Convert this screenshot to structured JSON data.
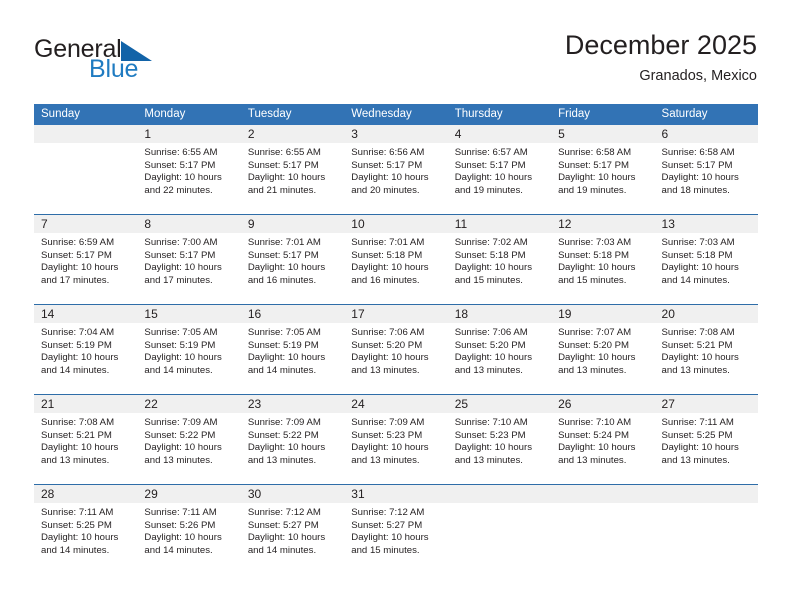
{
  "brand": {
    "name_part1": "General",
    "name_part2": "Blue",
    "triangle_color": "#1263a8",
    "blue_color": "#1f7bc1"
  },
  "header": {
    "title": "December 2025",
    "location": "Granados, Mexico",
    "header_bg": "#3273b5",
    "header_text_color": "#ffffff",
    "daynum_bg": "#f0f0f0",
    "week_rule_color": "#2e6da8"
  },
  "weekdays": [
    "Sunday",
    "Monday",
    "Tuesday",
    "Wednesday",
    "Thursday",
    "Friday",
    "Saturday"
  ],
  "weeks": [
    [
      {
        "day": "",
        "sunrise": "",
        "sunset": "",
        "daylight1": "",
        "daylight2": ""
      },
      {
        "day": "1",
        "sunrise": "Sunrise: 6:55 AM",
        "sunset": "Sunset: 5:17 PM",
        "daylight1": "Daylight: 10 hours",
        "daylight2": "and 22 minutes."
      },
      {
        "day": "2",
        "sunrise": "Sunrise: 6:55 AM",
        "sunset": "Sunset: 5:17 PM",
        "daylight1": "Daylight: 10 hours",
        "daylight2": "and 21 minutes."
      },
      {
        "day": "3",
        "sunrise": "Sunrise: 6:56 AM",
        "sunset": "Sunset: 5:17 PM",
        "daylight1": "Daylight: 10 hours",
        "daylight2": "and 20 minutes."
      },
      {
        "day": "4",
        "sunrise": "Sunrise: 6:57 AM",
        "sunset": "Sunset: 5:17 PM",
        "daylight1": "Daylight: 10 hours",
        "daylight2": "and 19 minutes."
      },
      {
        "day": "5",
        "sunrise": "Sunrise: 6:58 AM",
        "sunset": "Sunset: 5:17 PM",
        "daylight1": "Daylight: 10 hours",
        "daylight2": "and 19 minutes."
      },
      {
        "day": "6",
        "sunrise": "Sunrise: 6:58 AM",
        "sunset": "Sunset: 5:17 PM",
        "daylight1": "Daylight: 10 hours",
        "daylight2": "and 18 minutes."
      }
    ],
    [
      {
        "day": "7",
        "sunrise": "Sunrise: 6:59 AM",
        "sunset": "Sunset: 5:17 PM",
        "daylight1": "Daylight: 10 hours",
        "daylight2": "and 17 minutes."
      },
      {
        "day": "8",
        "sunrise": "Sunrise: 7:00 AM",
        "sunset": "Sunset: 5:17 PM",
        "daylight1": "Daylight: 10 hours",
        "daylight2": "and 17 minutes."
      },
      {
        "day": "9",
        "sunrise": "Sunrise: 7:01 AM",
        "sunset": "Sunset: 5:17 PM",
        "daylight1": "Daylight: 10 hours",
        "daylight2": "and 16 minutes."
      },
      {
        "day": "10",
        "sunrise": "Sunrise: 7:01 AM",
        "sunset": "Sunset: 5:18 PM",
        "daylight1": "Daylight: 10 hours",
        "daylight2": "and 16 minutes."
      },
      {
        "day": "11",
        "sunrise": "Sunrise: 7:02 AM",
        "sunset": "Sunset: 5:18 PM",
        "daylight1": "Daylight: 10 hours",
        "daylight2": "and 15 minutes."
      },
      {
        "day": "12",
        "sunrise": "Sunrise: 7:03 AM",
        "sunset": "Sunset: 5:18 PM",
        "daylight1": "Daylight: 10 hours",
        "daylight2": "and 15 minutes."
      },
      {
        "day": "13",
        "sunrise": "Sunrise: 7:03 AM",
        "sunset": "Sunset: 5:18 PM",
        "daylight1": "Daylight: 10 hours",
        "daylight2": "and 14 minutes."
      }
    ],
    [
      {
        "day": "14",
        "sunrise": "Sunrise: 7:04 AM",
        "sunset": "Sunset: 5:19 PM",
        "daylight1": "Daylight: 10 hours",
        "daylight2": "and 14 minutes."
      },
      {
        "day": "15",
        "sunrise": "Sunrise: 7:05 AM",
        "sunset": "Sunset: 5:19 PM",
        "daylight1": "Daylight: 10 hours",
        "daylight2": "and 14 minutes."
      },
      {
        "day": "16",
        "sunrise": "Sunrise: 7:05 AM",
        "sunset": "Sunset: 5:19 PM",
        "daylight1": "Daylight: 10 hours",
        "daylight2": "and 14 minutes."
      },
      {
        "day": "17",
        "sunrise": "Sunrise: 7:06 AM",
        "sunset": "Sunset: 5:20 PM",
        "daylight1": "Daylight: 10 hours",
        "daylight2": "and 13 minutes."
      },
      {
        "day": "18",
        "sunrise": "Sunrise: 7:06 AM",
        "sunset": "Sunset: 5:20 PM",
        "daylight1": "Daylight: 10 hours",
        "daylight2": "and 13 minutes."
      },
      {
        "day": "19",
        "sunrise": "Sunrise: 7:07 AM",
        "sunset": "Sunset: 5:20 PM",
        "daylight1": "Daylight: 10 hours",
        "daylight2": "and 13 minutes."
      },
      {
        "day": "20",
        "sunrise": "Sunrise: 7:08 AM",
        "sunset": "Sunset: 5:21 PM",
        "daylight1": "Daylight: 10 hours",
        "daylight2": "and 13 minutes."
      }
    ],
    [
      {
        "day": "21",
        "sunrise": "Sunrise: 7:08 AM",
        "sunset": "Sunset: 5:21 PM",
        "daylight1": "Daylight: 10 hours",
        "daylight2": "and 13 minutes."
      },
      {
        "day": "22",
        "sunrise": "Sunrise: 7:09 AM",
        "sunset": "Sunset: 5:22 PM",
        "daylight1": "Daylight: 10 hours",
        "daylight2": "and 13 minutes."
      },
      {
        "day": "23",
        "sunrise": "Sunrise: 7:09 AM",
        "sunset": "Sunset: 5:22 PM",
        "daylight1": "Daylight: 10 hours",
        "daylight2": "and 13 minutes."
      },
      {
        "day": "24",
        "sunrise": "Sunrise: 7:09 AM",
        "sunset": "Sunset: 5:23 PM",
        "daylight1": "Daylight: 10 hours",
        "daylight2": "and 13 minutes."
      },
      {
        "day": "25",
        "sunrise": "Sunrise: 7:10 AM",
        "sunset": "Sunset: 5:23 PM",
        "daylight1": "Daylight: 10 hours",
        "daylight2": "and 13 minutes."
      },
      {
        "day": "26",
        "sunrise": "Sunrise: 7:10 AM",
        "sunset": "Sunset: 5:24 PM",
        "daylight1": "Daylight: 10 hours",
        "daylight2": "and 13 minutes."
      },
      {
        "day": "27",
        "sunrise": "Sunrise: 7:11 AM",
        "sunset": "Sunset: 5:25 PM",
        "daylight1": "Daylight: 10 hours",
        "daylight2": "and 13 minutes."
      }
    ],
    [
      {
        "day": "28",
        "sunrise": "Sunrise: 7:11 AM",
        "sunset": "Sunset: 5:25 PM",
        "daylight1": "Daylight: 10 hours",
        "daylight2": "and 14 minutes."
      },
      {
        "day": "29",
        "sunrise": "Sunrise: 7:11 AM",
        "sunset": "Sunset: 5:26 PM",
        "daylight1": "Daylight: 10 hours",
        "daylight2": "and 14 minutes."
      },
      {
        "day": "30",
        "sunrise": "Sunrise: 7:12 AM",
        "sunset": "Sunset: 5:27 PM",
        "daylight1": "Daylight: 10 hours",
        "daylight2": "and 14 minutes."
      },
      {
        "day": "31",
        "sunrise": "Sunrise: 7:12 AM",
        "sunset": "Sunset: 5:27 PM",
        "daylight1": "Daylight: 10 hours",
        "daylight2": "and 15 minutes."
      },
      {
        "day": "",
        "sunrise": "",
        "sunset": "",
        "daylight1": "",
        "daylight2": ""
      },
      {
        "day": "",
        "sunrise": "",
        "sunset": "",
        "daylight1": "",
        "daylight2": ""
      },
      {
        "day": "",
        "sunrise": "",
        "sunset": "",
        "daylight1": "",
        "daylight2": ""
      }
    ]
  ]
}
